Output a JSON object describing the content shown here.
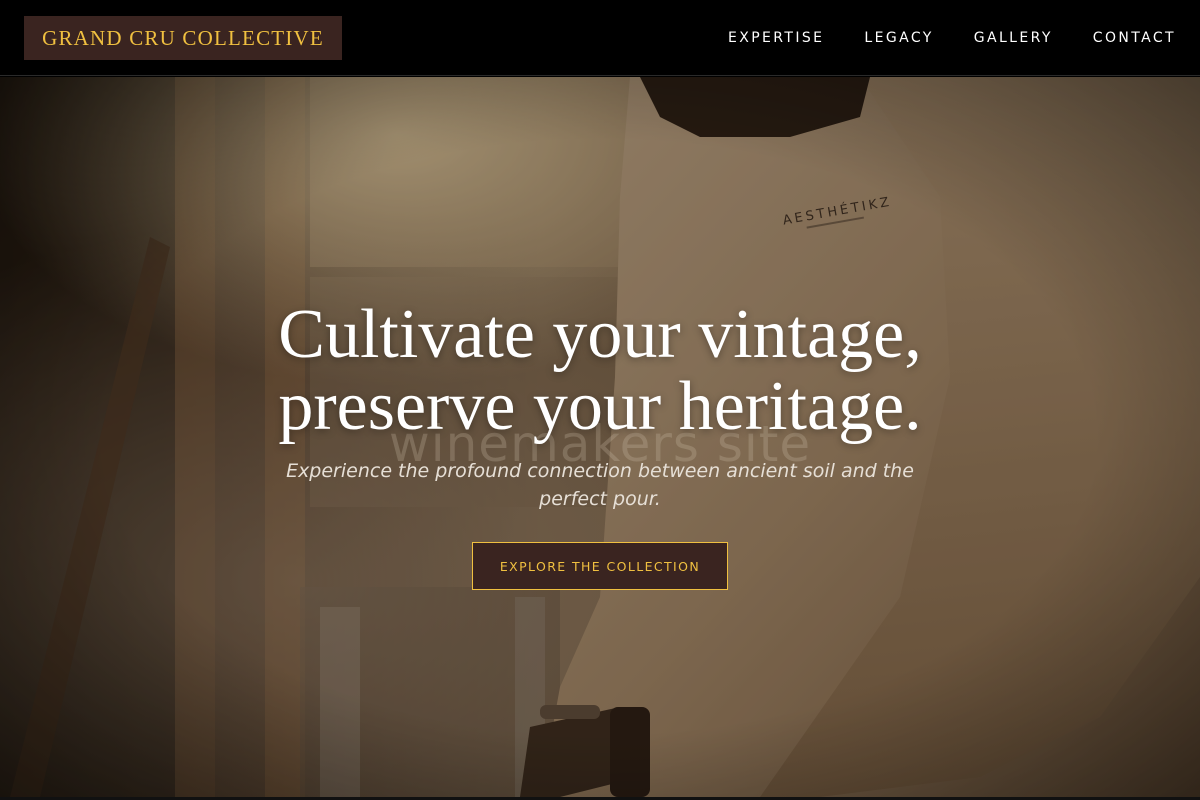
{
  "brand": {
    "name": "GRAND CRU COLLECTIVE"
  },
  "nav": {
    "items": [
      {
        "label": "EXPERTISE"
      },
      {
        "label": "LEGACY"
      },
      {
        "label": "GALLERY"
      },
      {
        "label": "CONTACT"
      }
    ]
  },
  "hero": {
    "headline_line1": "Cultivate your vintage,",
    "headline_line2": "preserve your heritage.",
    "watermark": "winemakers site",
    "subtitle": "Experience the profound connection between ancient soil and the perfect pour.",
    "cta_label": "EXPLORE THE COLLECTION",
    "background_image": "person-in-beige-sweatshirt-photo"
  },
  "colors": {
    "brand_background": "#3a2420",
    "accent_gold": "#f0c040",
    "nav_background": "#000000",
    "text_white": "#ffffff"
  }
}
